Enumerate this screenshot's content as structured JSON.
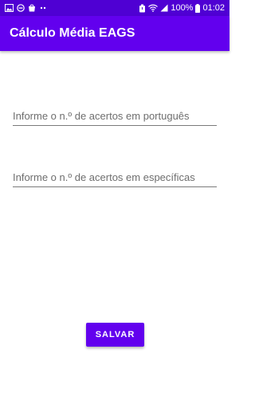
{
  "status_bar": {
    "left_icons": [
      "image-icon",
      "minus-circle-icon",
      "bag-icon",
      "dots-icon"
    ],
    "right_icons": [
      "alarm-icon",
      "wifi-icon",
      "signal-icon",
      "battery-icon"
    ],
    "battery": "100%",
    "time": "01:02"
  },
  "app_bar": {
    "title": "Cálculo Média EAGS"
  },
  "form": {
    "portugues_placeholder": "Informe o n.º de acertos em português",
    "portugues_value": "",
    "especificas_placeholder": "Informe o n.º de acertos em específicas",
    "especificas_value": "",
    "save_label": "SALVAR"
  },
  "colors": {
    "primary": "#6200ee",
    "primary_dark": "#4f00d3",
    "on_primary": "#ffffff"
  }
}
